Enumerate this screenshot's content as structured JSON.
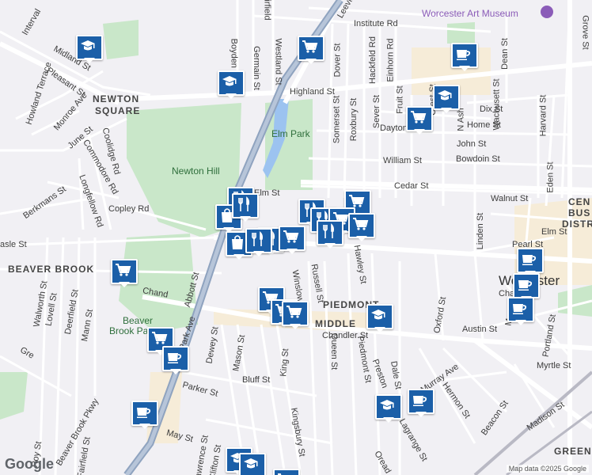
{
  "map": {
    "streets": [
      {
        "name": "Pleasant St"
      },
      {
        "name": "Highland St"
      },
      {
        "name": "Institute Rd"
      },
      {
        "name": "Elm St"
      },
      {
        "name": "William St"
      },
      {
        "name": "Cedar St"
      },
      {
        "name": "Chandler St"
      },
      {
        "name": "Austin St"
      },
      {
        "name": "Copley Rd"
      },
      {
        "name": "June St"
      },
      {
        "name": "Monroe Ave"
      },
      {
        "name": "Commodore Rd"
      },
      {
        "name": "Longfellow Rd"
      },
      {
        "name": "Berkmans St"
      },
      {
        "name": "Coolidge Rd"
      },
      {
        "name": "Howland Terrace"
      },
      {
        "name": "Midland St"
      },
      {
        "name": "Interval"
      },
      {
        "name": "Westland St"
      },
      {
        "name": "Germain St"
      },
      {
        "name": "Boyden St"
      },
      {
        "name": "Somerset St"
      },
      {
        "name": "Roxbury St"
      },
      {
        "name": "Hackfeld Rd"
      },
      {
        "name": "Dover St"
      },
      {
        "name": "Einhorn Rd"
      },
      {
        "name": "Sever St"
      },
      {
        "name": "Fruit St"
      },
      {
        "name": "Dix St"
      },
      {
        "name": "Home St"
      },
      {
        "name": "John St"
      },
      {
        "name": "Bowdoin St"
      },
      {
        "name": "Dayton"
      },
      {
        "name": "Dean St"
      },
      {
        "name": "Wachusett St"
      },
      {
        "name": "Harvard St"
      },
      {
        "name": "Eden St"
      },
      {
        "name": "Walnut St"
      },
      {
        "name": "Linden St"
      },
      {
        "name": "Pearl St"
      },
      {
        "name": "Elm St"
      },
      {
        "name": "Chatham"
      },
      {
        "name": "Oxford St"
      },
      {
        "name": "Hawley St"
      },
      {
        "name": "Russell St"
      },
      {
        "name": "Winslow St"
      },
      {
        "name": "Queen St"
      },
      {
        "name": "Piedmont St"
      },
      {
        "name": "Preston"
      },
      {
        "name": "Dale St"
      },
      {
        "name": "Murray Ave"
      },
      {
        "name": "Hermon St"
      },
      {
        "name": "Beacon St"
      },
      {
        "name": "Madison St"
      },
      {
        "name": "Myrtle St"
      },
      {
        "name": "Portland St"
      },
      {
        "name": "Grove St"
      },
      {
        "name": "Lagrange St"
      },
      {
        "name": "Oread"
      },
      {
        "name": "Kingsbury St"
      },
      {
        "name": "King St"
      },
      {
        "name": "Bluff St"
      },
      {
        "name": "Mason St"
      },
      {
        "name": "Dewey St"
      },
      {
        "name": "Parker St"
      },
      {
        "name": "May St"
      },
      {
        "name": "Abbott St"
      },
      {
        "name": "Park Ave"
      },
      {
        "name": "Beaver Brook Pkwy"
      },
      {
        "name": "Mann St"
      },
      {
        "name": "Deerfield St"
      },
      {
        "name": "Lovell St"
      },
      {
        "name": "Walworth St"
      },
      {
        "name": "Roy St"
      },
      {
        "name": "Fairfield St"
      },
      {
        "name": "Clifton St"
      },
      {
        "name": "Lawrence St"
      },
      {
        "name": "Chand"
      },
      {
        "name": "Fairfield"
      },
      {
        "name": "Leeville"
      },
      {
        "name": "asle St"
      },
      {
        "name": "N Ash"
      },
      {
        "name": "Ma"
      },
      {
        "name": "Crest St"
      },
      {
        "name": "Gre"
      }
    ],
    "areas": [
      {
        "name": "NEWTON"
      },
      {
        "name": "SQUARE"
      },
      {
        "name": "BEAVER BROOK"
      },
      {
        "name": "PIEDMONT"
      },
      {
        "name": "MIDDLE"
      },
      {
        "name": "CEN"
      },
      {
        "name": "BUS"
      },
      {
        "name": "DISTR"
      },
      {
        "name": "GREEN"
      }
    ],
    "parks": [
      {
        "name": "Elm Park"
      },
      {
        "name": "Newton Hill"
      },
      {
        "name": "Beaver"
      },
      {
        "name": "Brook Park"
      }
    ],
    "city": "Worcester",
    "museum": "Worcester Art Museum",
    "logo": "Google",
    "attribution": "Map data ©2025 Google",
    "colors": {
      "pin": "#1b5fa8",
      "park": "#c9e7c9",
      "highway": "#8fa3bf",
      "background": "#f1f0f4"
    },
    "markers": [
      {
        "type": "school",
        "icon": "school-icon"
      },
      {
        "type": "grocery",
        "icon": "cart-icon"
      },
      {
        "type": "cafe",
        "icon": "cup-icon"
      },
      {
        "type": "restaurant",
        "icon": "fork-knife-icon"
      },
      {
        "type": "shopping",
        "icon": "bag-icon"
      }
    ]
  }
}
